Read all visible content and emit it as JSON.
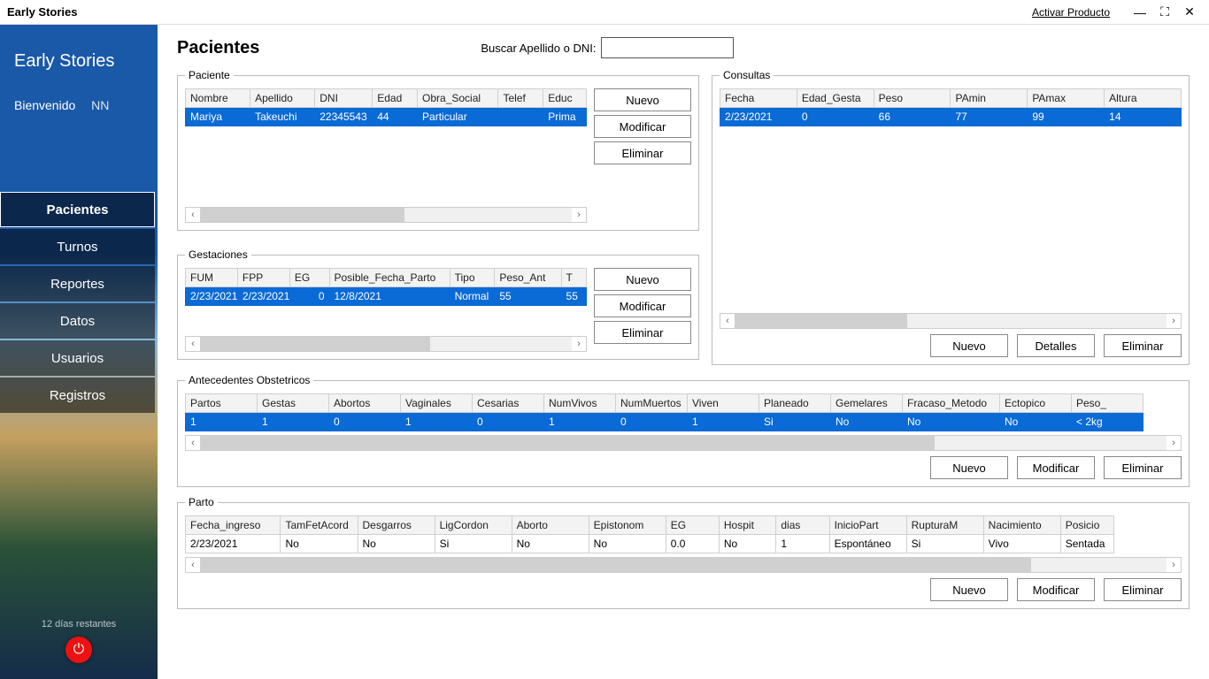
{
  "titlebar": {
    "title": "Early Stories",
    "activate": "Activar Producto"
  },
  "sidebar": {
    "app_name": "Early Stories",
    "welcome_label": "Bienvenido",
    "user": "NN",
    "nav": [
      "Pacientes",
      "Turnos",
      "Reportes",
      "Datos",
      "Usuarios",
      "Registros"
    ],
    "trial": "12 días restantes"
  },
  "page": {
    "heading": "Pacientes",
    "search_label": "Buscar Apellido o DNI:",
    "search_value": ""
  },
  "buttons": {
    "nuevo": "Nuevo",
    "modificar": "Modificar",
    "eliminar": "Eliminar",
    "detalles": "Detalles"
  },
  "paciente": {
    "legend": "Paciente",
    "headers": [
      "Nombre",
      "Apellido",
      "DNI",
      "Edad",
      "Obra_Social",
      "Telef",
      "Educ"
    ],
    "row": [
      "Mariya",
      "Takeuchi",
      "22345543",
      "44",
      "Particular",
      "",
      "Prima"
    ]
  },
  "gestaciones": {
    "legend": "Gestaciones",
    "headers": [
      "FUM",
      "FPP",
      "EG",
      "Posible_Fecha_Parto",
      "Tipo",
      "Peso_Ant",
      "T"
    ],
    "row": [
      "2/23/2021",
      "2/23/2021",
      "0",
      "12/8/2021",
      "Normal",
      "55",
      "55"
    ]
  },
  "consultas": {
    "legend": "Consultas",
    "headers": [
      "Fecha",
      "Edad_Gesta",
      "Peso",
      "PAmin",
      "PAmax",
      "Altura"
    ],
    "row": [
      "2/23/2021",
      "0",
      "66",
      "77",
      "99",
      "14"
    ]
  },
  "antecedentes": {
    "legend": "Antecedentes Obstetricos",
    "headers": [
      "Partos",
      "Gestas",
      "Abortos",
      "Vaginales",
      "Cesarias",
      "NumVivos",
      "NumMuertos",
      "Viven",
      "Planeado",
      "Gemelares",
      "Fracaso_Metodo",
      "Ectopico",
      "Peso_"
    ],
    "row": [
      "1",
      "1",
      "0",
      "1",
      "0",
      "1",
      "0",
      "1",
      "Si",
      "No",
      "No",
      "No",
      "< 2kg"
    ]
  },
  "parto": {
    "legend": "Parto",
    "headers": [
      "Fecha_ingreso",
      "TamFetAcord",
      "Desgarros",
      "LigCordon",
      "Aborto",
      "Epistonom",
      "EG",
      "Hospit",
      "dias",
      "InicioPart",
      "RupturaM",
      "Nacimiento",
      "Posicio"
    ],
    "row": [
      "2/23/2021",
      "No",
      "No",
      "Si",
      "No",
      "No",
      "0.0",
      "No",
      "1",
      "Espontáneo",
      "Si",
      "Vivo",
      "Sentada"
    ]
  }
}
